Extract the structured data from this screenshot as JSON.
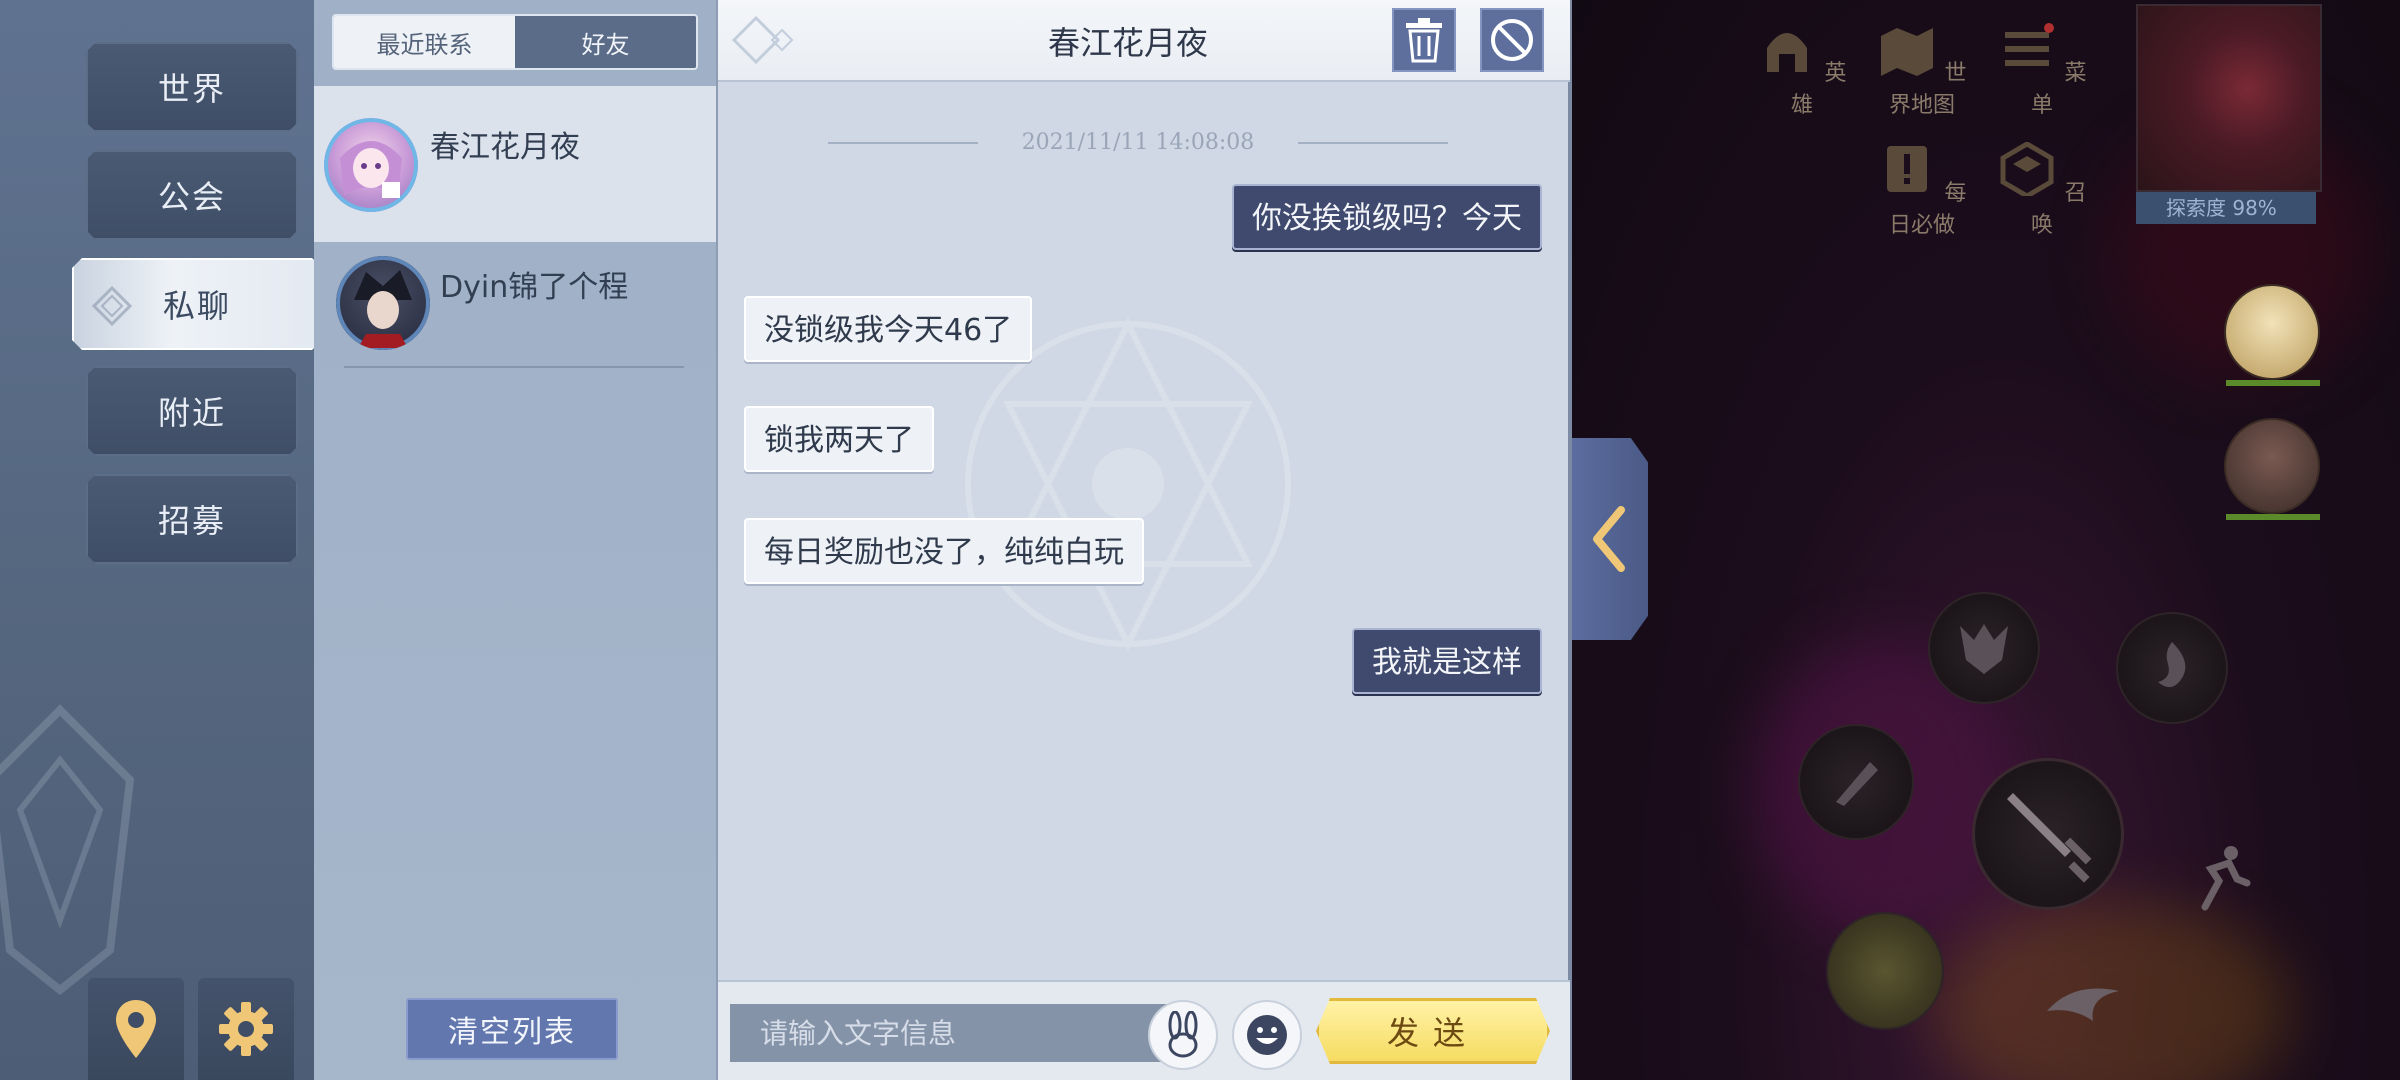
{
  "left_nav": {
    "items": [
      {
        "label": "世界",
        "active": false
      },
      {
        "label": "公会",
        "active": false
      },
      {
        "label": "私聊",
        "active": true
      },
      {
        "label": "附近",
        "active": false
      },
      {
        "label": "招募",
        "active": false
      }
    ],
    "bottom_buttons": [
      "location-pin-icon",
      "gear-icon"
    ]
  },
  "contacts": {
    "tabs": [
      {
        "label": "最近联系",
        "active": true
      },
      {
        "label": "好友",
        "active": false
      }
    ],
    "list": [
      {
        "name": "春江花月夜",
        "selected": true
      },
      {
        "name": "Dyin锦了个程",
        "selected": false
      }
    ],
    "clear_label": "清空列表"
  },
  "chat": {
    "title": "春江花月夜",
    "header_buttons": [
      "trash-icon",
      "block-icon"
    ],
    "timestamp": "2021/11/11 14:08:08",
    "messages": [
      {
        "direction": "out",
        "text": "你没挨锁级吗？今天"
      },
      {
        "direction": "in",
        "text": "没锁级我今天46了"
      },
      {
        "direction": "in",
        "text": "锁我两天了"
      },
      {
        "direction": "in",
        "text": "每日奖励也没了，纯纯白玩"
      },
      {
        "direction": "out",
        "text": "我就是这样"
      }
    ],
    "input_placeholder": "请输入文字信息",
    "send_label": "发送"
  },
  "game_hud": {
    "top_icons": [
      {
        "label": "英雄",
        "icon": "helmet-icon"
      },
      {
        "label": "世界地图",
        "icon": "map-icon"
      },
      {
        "label": "菜单",
        "icon": "menu-icon"
      },
      {
        "label": "每日必做",
        "icon": "daily-quest-icon"
      },
      {
        "label": "召唤",
        "icon": "summon-icon"
      }
    ],
    "explore_label": "探索度 98%",
    "colors": {
      "accent": "#5e6f9d",
      "send": "#f6dc62",
      "nav_active": "#eef2f7"
    }
  }
}
